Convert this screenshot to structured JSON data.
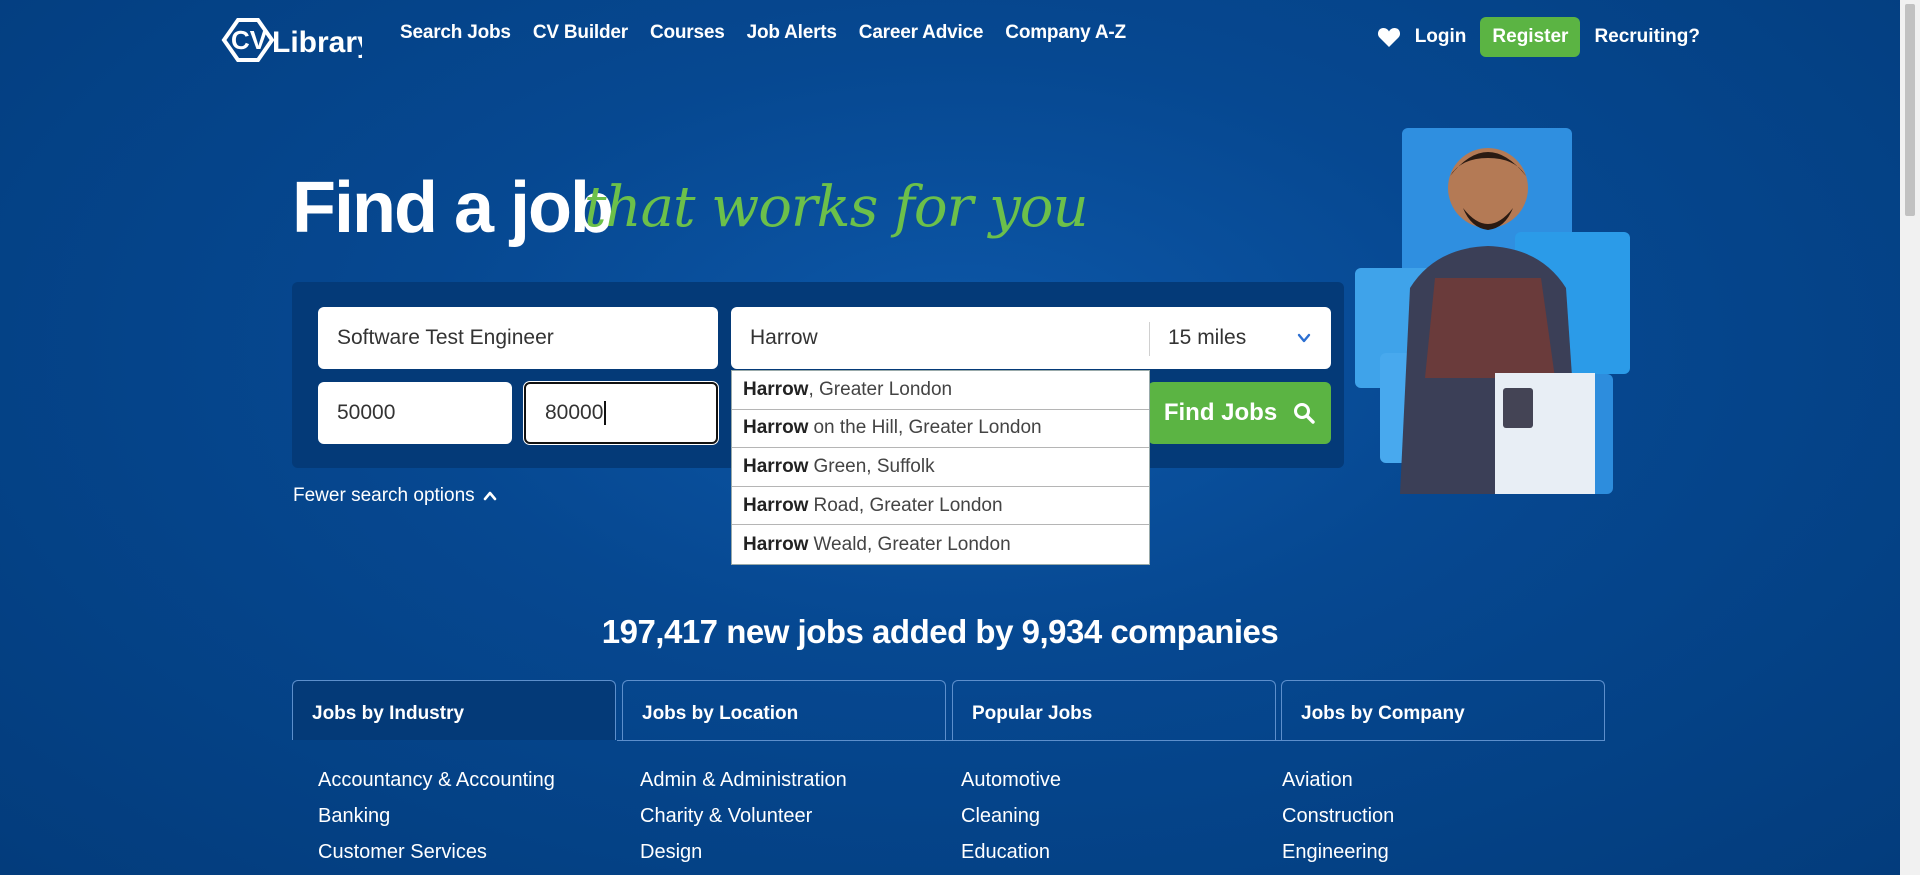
{
  "header": {
    "logo_text": "CV Library",
    "nav": [
      "Search Jobs",
      "CV Builder",
      "Courses",
      "Job Alerts",
      "Career Advice",
      "Company A-Z"
    ],
    "login": "Login",
    "register": "Register",
    "recruiting": "Recruiting?"
  },
  "hero": {
    "title": "Find a job",
    "tagline": "that works for you"
  },
  "search": {
    "keywords_value": "Software Test Engineer",
    "location_value": "Harrow",
    "radius_value": "15 miles",
    "salary_min_value": "50000",
    "salary_max_value": "80000",
    "find_jobs_label": "Find Jobs",
    "fewer_options_label": "Fewer search options"
  },
  "autocomplete": [
    {
      "match": "Harrow",
      "rest": ", Greater London"
    },
    {
      "match": "Harrow",
      "rest": "on the Hill, Greater London"
    },
    {
      "match": "Harrow",
      "rest": "Green, Suffolk"
    },
    {
      "match": "Harrow",
      "rest": "Road, Greater London"
    },
    {
      "match": "Harrow",
      "rest": "Weald, Greater London"
    }
  ],
  "stats": "197,417 new jobs added by 9,934 companies",
  "tabs": [
    "Jobs by Industry",
    "Jobs by Location",
    "Popular Jobs",
    "Jobs by Company"
  ],
  "columns": [
    [
      "Accountancy & Accounting",
      "Banking",
      "Customer Services"
    ],
    [
      "Admin & Administration",
      "Charity & Volunteer",
      "Design"
    ],
    [
      "Automotive",
      "Cleaning",
      "Education"
    ],
    [
      "Aviation",
      "Construction",
      "Engineering"
    ]
  ],
  "colors": {
    "background": "#064891",
    "accent_green": "#5bb443",
    "tagline_green": "#6cc04a"
  }
}
